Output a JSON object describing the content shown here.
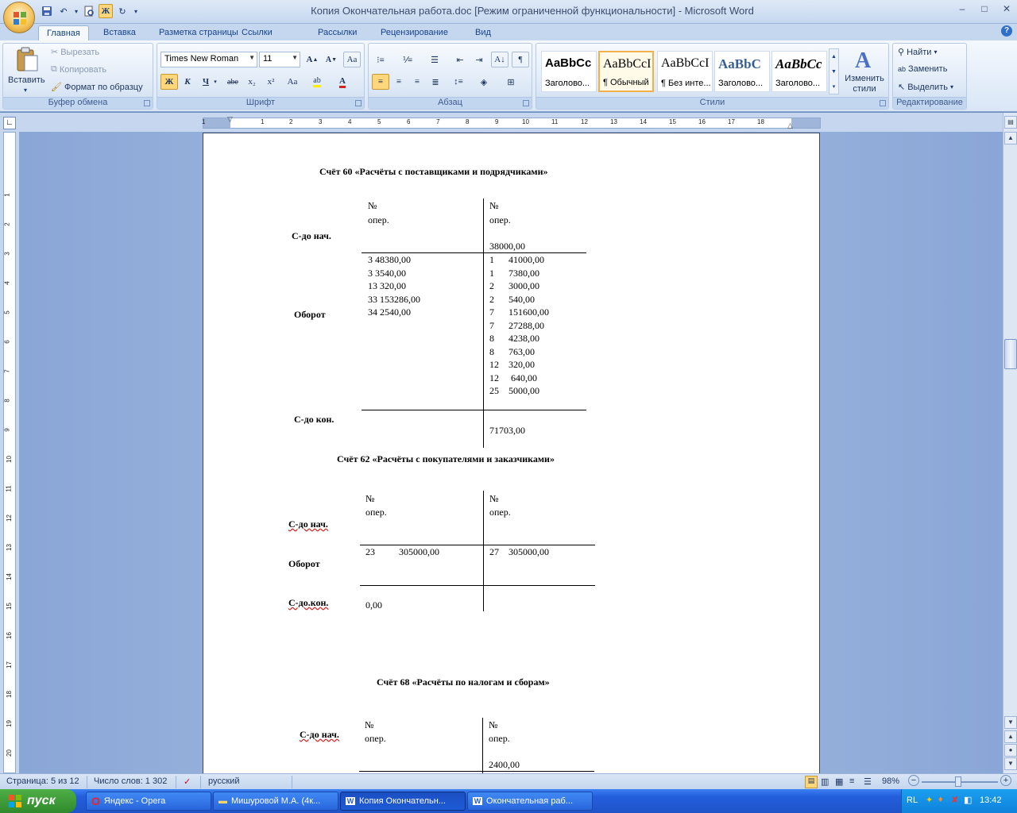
{
  "window": {
    "title": "Копия Окончательная работа.doc [Режим ограниченной функциональности] - Microsoft Word",
    "controls": [
      "–",
      "□",
      "✕"
    ]
  },
  "qat": {
    "bold_toggle": "Ж"
  },
  "tabs": [
    "Главная",
    "Вставка",
    "Разметка страницы",
    "Ссылки",
    "Рассылки",
    "Рецензирование",
    "Вид"
  ],
  "ribbon": {
    "clipboard": {
      "paste": "Вставить",
      "cut": "Вырезать",
      "copy": "Копировать",
      "format_painter": "Формат по образцу",
      "label": "Буфер обмена"
    },
    "font": {
      "family": "Times New Roman",
      "size": "11",
      "bold": "Ж",
      "italic": "К",
      "underline": "Ч",
      "strike": "abe",
      "sub": "x₂",
      "sup": "x²",
      "case": "Aa",
      "label": "Шрифт"
    },
    "paragraph": {
      "label": "Абзац"
    },
    "styles": {
      "label": "Стили",
      "tiles": [
        {
          "sample": "AaBbCc",
          "name": "Заголово..."
        },
        {
          "sample": "AaBbCcI",
          "name": "¶ Обычный"
        },
        {
          "sample": "AaBbCcI",
          "name": "¶ Без инте..."
        },
        {
          "sample": "AaBbC",
          "name": "Заголово..."
        },
        {
          "sample": "AaBbCc",
          "name": "Заголово..."
        }
      ],
      "change_styles": "Изменить стили"
    },
    "editing": {
      "find": "Найти",
      "replace": "Заменить",
      "select": "Выделить",
      "label": "Редактирование"
    }
  },
  "ruler": {
    "h_numbers": [
      "1",
      "1",
      "2",
      "3",
      "4",
      "5",
      "6",
      "7",
      "8",
      "9",
      "10",
      "11",
      "12",
      "13",
      "14",
      "15",
      "16",
      "17",
      "18"
    ],
    "v_numbers": [
      "1",
      "2",
      "3",
      "4",
      "5",
      "6",
      "7",
      "8",
      "9",
      "10",
      "11",
      "12",
      "13",
      "14",
      "15",
      "16",
      "17",
      "18",
      "19",
      "20"
    ]
  },
  "document": {
    "acc60": {
      "title": "Счёт 60 «Расчёты с поставщиками и подрядчиками»",
      "num": "№",
      "oper": "опер.",
      "s_start": "С-до нач.",
      "credit_start": "38000,00",
      "turnover": "Оборот",
      "debit": [
        "3    48380,00",
        "3    3540,00",
        "13  320,00",
        "33  153286,00",
        "34   2540,00"
      ],
      "credit": [
        "1      41000,00",
        "1      7380,00",
        "2      3000,00",
        "2      540,00",
        "7      151600,00",
        "7      27288,00",
        "8      4238,00",
        "8      763,00",
        "12    320,00",
        "12     640,00",
        "25    5000,00"
      ],
      "s_end": "С-до кон.",
      "credit_end": "71703,00"
    },
    "acc62": {
      "title": "Счёт 62 «Расчёты  с покупателями и заказчиками»",
      "num": "№",
      "oper": "опер.",
      "s_start": "С-до нач.",
      "turnover": "Оборот",
      "debit": "23          305000,00",
      "credit": "27    305000,00",
      "s_end": "С-до.кон.",
      "debit_end": "0,00"
    },
    "acc68": {
      "title": "Счёт 68 «Расчёты  по налогам  и сборам»",
      "num": "№",
      "oper": "опер.",
      "s_start": "С-до нач.",
      "credit_start": "2400,00"
    }
  },
  "status": {
    "page": "Страница: 5 из 12",
    "words": "Число слов: 1 302",
    "lang": "русский",
    "zoom": "98%"
  },
  "taskbar": {
    "start": "пуск",
    "items": [
      "Яндекс - Opera",
      "Мишуровой М.А. (4к...",
      "Копия Окончательн...",
      "Окончательная раб..."
    ],
    "tray_lang": "RL",
    "clock": "13:42"
  }
}
